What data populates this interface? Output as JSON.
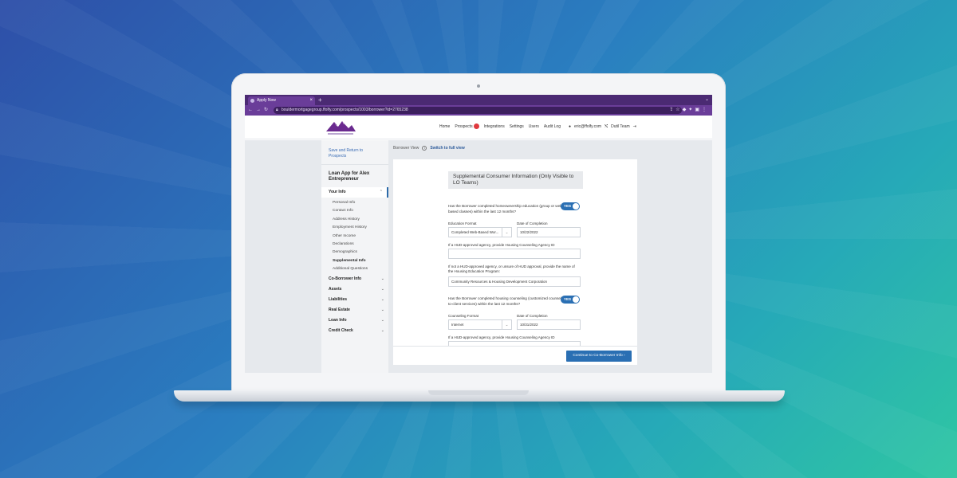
{
  "browser": {
    "tab_title": "Apply Now",
    "new_tab": "+",
    "url": "bouldermortgagegroup.ffolfy.com/prospects/1003/borrower?id=2765238"
  },
  "header": {
    "nav": [
      "Home",
      "Prospects",
      "Integrations",
      "Settings",
      "Users",
      "Audit Log"
    ],
    "prospects_badge": "",
    "user_email": "eric@ffolfy.com",
    "team": "Dutil Team"
  },
  "sidebar": {
    "save_link": "Save and Return to Prospects",
    "app_title": "Loan App for Alex Entrepreneur",
    "your_info": "Your Info",
    "sub_items": [
      "Personal Info",
      "Contact Info",
      "Address History",
      "Employment History",
      "Other Income",
      "Declarations",
      "Demographics",
      "Supplemental Info",
      "Additional Questions"
    ],
    "current_sub": "Supplemental Info",
    "sections": [
      "Co-Borrower Info",
      "Assets",
      "Liabilities",
      "Real Estate",
      "Loan Info",
      "Credit Check"
    ]
  },
  "view": {
    "label": "Borrower View",
    "switch_link": "Switch to full view"
  },
  "form": {
    "title": "Supplemental Consumer Information (Only Visible to LO Teams)",
    "q1": "Has the Borrower completed homeownership education (group or web-based classes) within the last 12 months?",
    "q1_toggle": "YES",
    "education_format_label": "Education Format",
    "education_format_value": "Completed Web-Based Wor...",
    "date_label": "Date of Completion",
    "education_date": "10/22/2022",
    "hud_id_label": "If a HUD-approved agency, provide Housing Counseling Agency ID",
    "hud_id_value": "",
    "program_label": "If not a HUD-approved agency, or unsure of HUD approval, provide the name of the Housing Education Program:",
    "program_value": "Community Resources & Housing Development Corporation",
    "q2": "Has the Borrower completed housing counseling (customized counselor-to-client services) within the last 12 months?",
    "q2_toggle": "YES",
    "counseling_format_label": "Counseling Format",
    "counseling_format_value": "Internet",
    "counseling_date_label": "Date of Completion",
    "counseling_date": "10/31/2022",
    "hud_id_label_2": "If a HUD-approved agency, provide Housing Counseling Agency ID"
  },
  "footer": {
    "continue_button": "Continue to Co-Borrower Info"
  },
  "colors": {
    "browser_purple": "#6a3d99",
    "primary_blue": "#2a6fb3",
    "badge_red": "#e0393e"
  }
}
